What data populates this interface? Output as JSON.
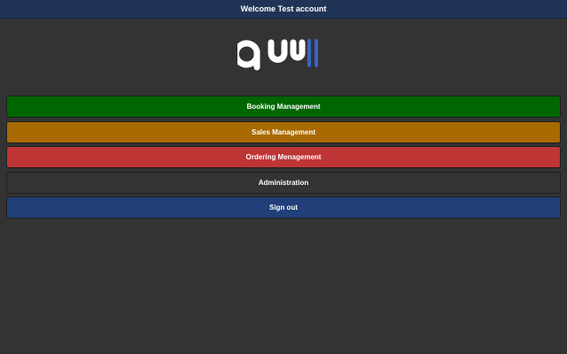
{
  "header": {
    "welcome_text": "Welcome Test account"
  },
  "logo": {
    "text": "quw",
    "accent_color": "#3b63c4",
    "icon": "quw-logo"
  },
  "menu": {
    "booking_label": "Booking Management",
    "sales_label": "Sales Management",
    "ordering_label": "Ordering Menagement",
    "admin_label": "Administration",
    "signout_label": "Sign out"
  },
  "colors": {
    "header_bg": "#213458",
    "page_bg": "#333333",
    "booking": "#006600",
    "sales": "#a86a00",
    "ordering": "#bf3535",
    "admin": "#333333",
    "signout": "#213f78"
  }
}
